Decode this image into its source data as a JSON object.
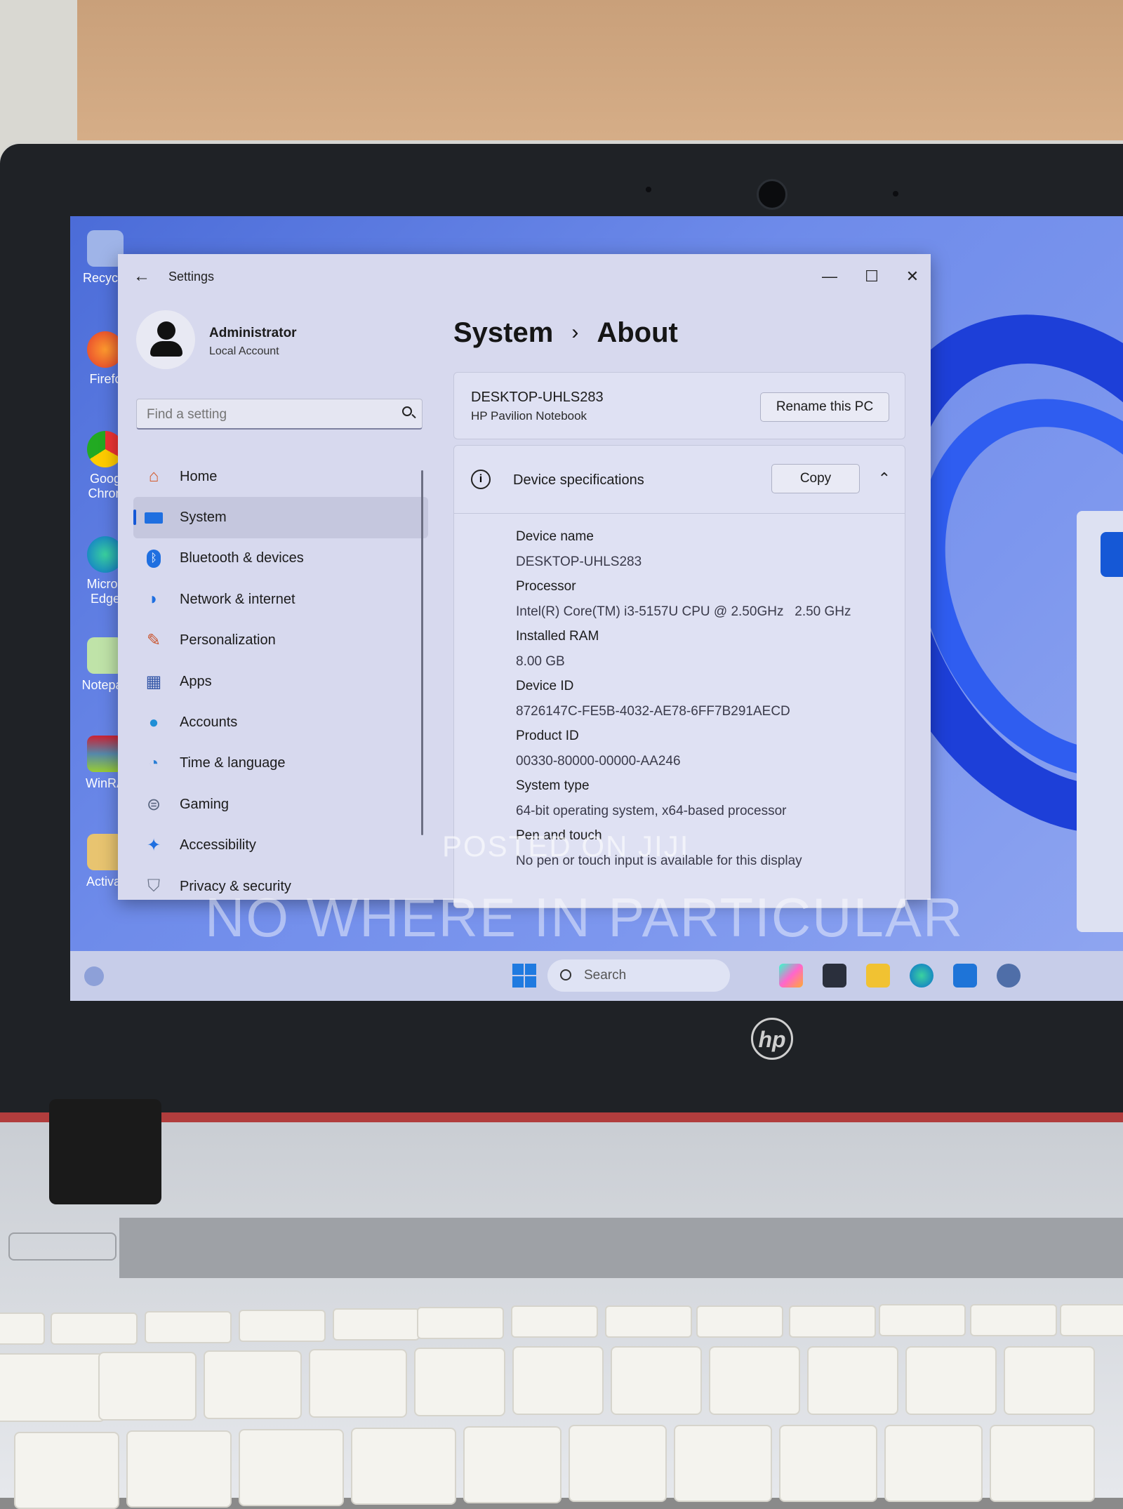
{
  "desktop": {
    "icons": [
      "Recycle",
      "Firefc",
      "Goog Chron",
      "Micros Edge",
      "Notepac",
      "WinRA",
      "Activat"
    ]
  },
  "window": {
    "app_title": "Settings",
    "controls": {
      "minimize": "—",
      "maximize": "☐",
      "close": "✕"
    }
  },
  "account": {
    "name": "Administrator",
    "type": "Local Account"
  },
  "search": {
    "placeholder": "Find a setting"
  },
  "nav": {
    "items": [
      {
        "label": "Home"
      },
      {
        "label": "System"
      },
      {
        "label": "Bluetooth & devices"
      },
      {
        "label": "Network & internet"
      },
      {
        "label": "Personalization"
      },
      {
        "label": "Apps"
      },
      {
        "label": "Accounts"
      },
      {
        "label": "Time & language"
      },
      {
        "label": "Gaming"
      },
      {
        "label": "Accessibility"
      },
      {
        "label": "Privacy & security"
      }
    ],
    "active": "System"
  },
  "breadcrumb": {
    "parent": "System",
    "separator": "›",
    "current": "About"
  },
  "pc_card": {
    "name": "DESKTOP-UHLS283",
    "model": "HP Pavilion Notebook",
    "rename_label": "Rename this PC"
  },
  "specs": {
    "title": "Device specifications",
    "copy_label": "Copy",
    "rows": [
      {
        "label": "Device name",
        "value": "DESKTOP-UHLS283"
      },
      {
        "label": "Processor",
        "value": "Intel(R) Core(TM) i3-5157U CPU @ 2.50GHz   2.50 GHz"
      },
      {
        "label": "Installed RAM",
        "value": "8.00 GB"
      },
      {
        "label": "Device ID",
        "value": "8726147C-FE5B-4032-AE78-6FF7B291AECD"
      },
      {
        "label": "Product ID",
        "value": "00330-80000-00000-AA246"
      },
      {
        "label": "System type",
        "value": "64-bit operating system, x64-based processor"
      },
      {
        "label": "Pen and touch",
        "value": "No pen or touch input is available for this display"
      }
    ]
  },
  "watermarks": {
    "line1": "POSTED ON JIJI",
    "line2": "NO WHERE IN PARTICULAR"
  },
  "taskbar": {
    "search_label": "Search"
  },
  "laptop": {
    "brand": "hp"
  },
  "colors": {
    "accent": "#1558d6",
    "window_bg": "#d7d9ee",
    "wallpaper": "#4b6cd8"
  }
}
